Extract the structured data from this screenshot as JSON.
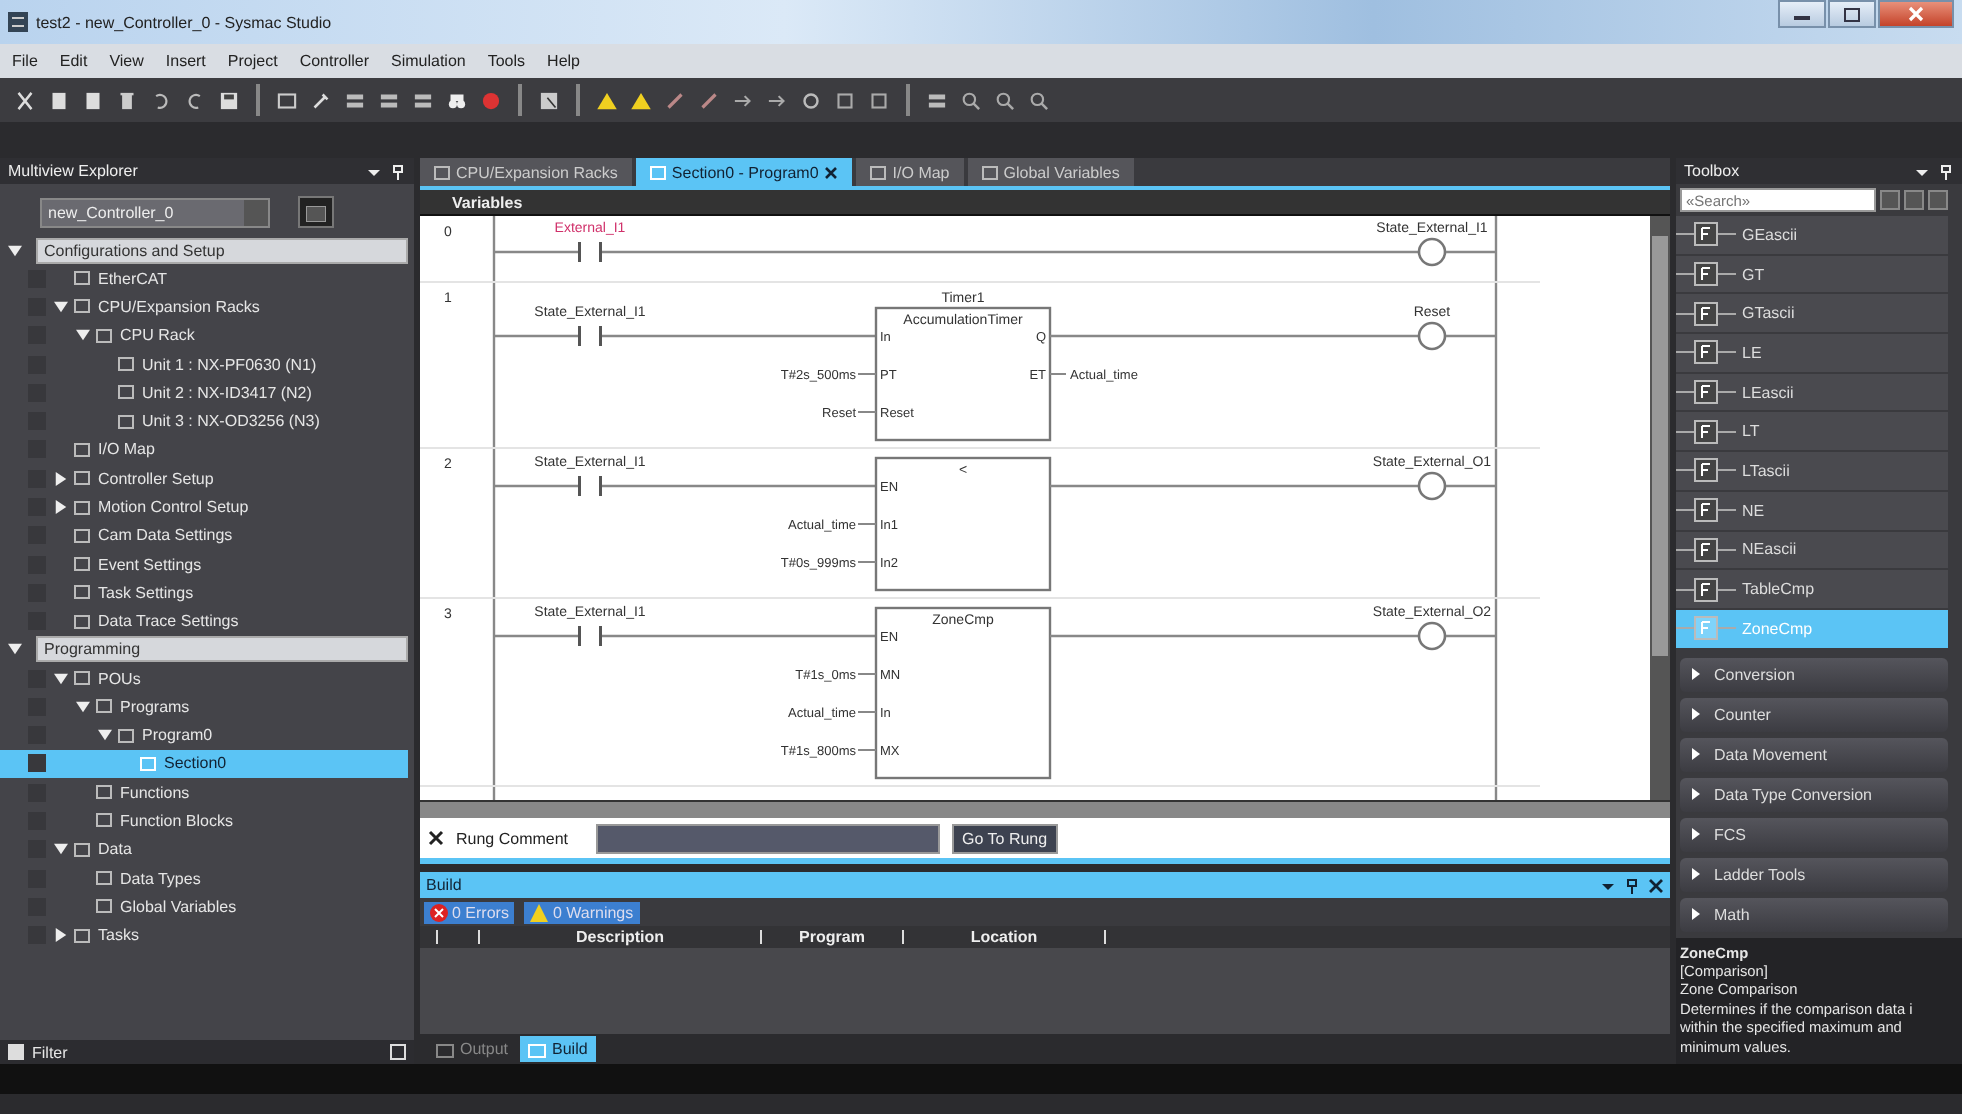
{
  "window": {
    "title": "test2 - new_Controller_0 - Sysmac Studio"
  },
  "menu": [
    "File",
    "Edit",
    "View",
    "Insert",
    "Project",
    "Controller",
    "Simulation",
    "Tools",
    "Help"
  ],
  "explorer": {
    "title": "Multiview Explorer",
    "device": "new_Controller_0",
    "filter": "Filter",
    "tree": [
      {
        "label": "Configurations and Setup",
        "selected": false,
        "expanded": true,
        "children": [
          {
            "label": "EtherCAT",
            "selected": false
          },
          {
            "label": "CPU/Expansion Racks",
            "selected": false,
            "expanded": true,
            "children": [
              {
                "label": "CPU Rack",
                "selected": false,
                "expanded": true,
                "children": [
                  {
                    "label": "Unit 1 : NX-PF0630 (N1)",
                    "selected": false
                  },
                  {
                    "label": "Unit 2 : NX-ID3417 (N2)",
                    "selected": false
                  },
                  {
                    "label": "Unit 3 : NX-OD3256 (N3)",
                    "selected": false
                  }
                ]
              }
            ]
          },
          {
            "label": "I/O Map",
            "selected": false
          },
          {
            "label": "Controller Setup",
            "selected": false,
            "expanded": false
          },
          {
            "label": "Motion Control Setup",
            "selected": false,
            "expanded": false
          },
          {
            "label": "Cam Data Settings",
            "selected": false
          },
          {
            "label": "Event Settings",
            "selected": false
          },
          {
            "label": "Task Settings",
            "selected": false
          },
          {
            "label": "Data Trace Settings",
            "selected": false
          }
        ]
      },
      {
        "label": "Programming",
        "selected": false,
        "expanded": true,
        "children": [
          {
            "label": "POUs",
            "selected": false,
            "expanded": true,
            "children": [
              {
                "label": "Programs",
                "selected": false,
                "expanded": true,
                "children": [
                  {
                    "label": "Program0",
                    "selected": false,
                    "expanded": true,
                    "children": [
                      {
                        "label": "Section0",
                        "selected": true
                      }
                    ]
                  }
                ]
              },
              {
                "label": "Functions",
                "selected": false
              },
              {
                "label": "Function Blocks",
                "selected": false
              }
            ]
          },
          {
            "label": "Data",
            "selected": false,
            "expanded": true,
            "children": [
              {
                "label": "Data Types",
                "selected": false
              },
              {
                "label": "Global Variables",
                "selected": false
              }
            ]
          },
          {
            "label": "Tasks",
            "selected": false,
            "expanded": false
          }
        ]
      }
    ]
  },
  "editor": {
    "tabs": [
      {
        "label": "CPU/Expansion Racks",
        "selected": false,
        "closable": false
      },
      {
        "label": "Section0 - Program0",
        "selected": true,
        "closable": true
      },
      {
        "label": "I/O Map",
        "selected": false,
        "closable": false
      },
      {
        "label": "Global Variables",
        "selected": false,
        "closable": false
      }
    ],
    "variables": "Variables",
    "rungs": [
      {
        "number": "0",
        "contact": {
          "label": "External_I1",
          "invalid": true
        },
        "coil": {
          "label": "State_External_I1"
        }
      },
      {
        "number": "1",
        "contact": {
          "label": "State_External_I1",
          "invalid": false
        },
        "block": {
          "instance": "Timer1",
          "type": "AccumulationTimer",
          "inputs": [
            {
              "pin": "In"
            },
            {
              "pin": "PT",
              "var": "T#2s_500ms"
            },
            {
              "pin": "Reset",
              "var": "Reset"
            }
          ],
          "outputs": [
            {
              "pin": "Q"
            },
            {
              "pin": "ET",
              "var": "Actual_time"
            }
          ]
        },
        "coil": {
          "label": "Reset"
        }
      },
      {
        "number": "2",
        "contact": {
          "label": "State_External_I1",
          "invalid": false
        },
        "block": {
          "type": "<",
          "inputs": [
            {
              "pin": "EN"
            },
            {
              "pin": "In1",
              "var": "Actual_time"
            },
            {
              "pin": "In2",
              "var": "T#0s_999ms"
            }
          ]
        },
        "coil": {
          "label": "State_External_O1"
        }
      },
      {
        "number": "3",
        "contact": {
          "label": "State_External_I1",
          "invalid": false
        },
        "block": {
          "type": "ZoneCmp",
          "inputs": [
            {
              "pin": "EN"
            },
            {
              "pin": "MN",
              "var": "T#1s_0ms"
            },
            {
              "pin": "In",
              "var": "Actual_time"
            },
            {
              "pin": "MX",
              "var": "T#1s_800ms"
            }
          ]
        },
        "coil": {
          "label": "State_External_O2"
        }
      }
    ],
    "rung_comment": {
      "label": "Rung Comment",
      "button": "Go To Rung"
    }
  },
  "build": {
    "title": "Build",
    "errors": "0 Errors",
    "warnings": "0 Warnings",
    "columns": [
      "Description",
      "Program",
      "Location"
    ]
  },
  "bottom_tabs": [
    {
      "label": "Output",
      "selected": false
    },
    {
      "label": "Build",
      "selected": true
    }
  ],
  "toolbox": {
    "title": "Toolbox",
    "search": {
      "placeholder": "«Search»"
    },
    "functions": [
      {
        "label": "GEascii",
        "selected": false
      },
      {
        "label": "GT",
        "selected": false
      },
      {
        "label": "GTascii",
        "selected": false
      },
      {
        "label": "LE",
        "selected": false
      },
      {
        "label": "LEascii",
        "selected": false
      },
      {
        "label": "LT",
        "selected": false
      },
      {
        "label": "LTascii",
        "selected": false
      },
      {
        "label": "NE",
        "selected": false
      },
      {
        "label": "NEascii",
        "selected": false
      },
      {
        "label": "TableCmp",
        "selected": false
      },
      {
        "label": "ZoneCmp",
        "selected": true
      }
    ],
    "categories": [
      {
        "label": "Conversion",
        "expanded": false
      },
      {
        "label": "Counter",
        "expanded": false
      },
      {
        "label": "Data Movement",
        "expanded": false
      },
      {
        "label": "Data Type Conversion",
        "expanded": false
      },
      {
        "label": "FCS",
        "expanded": false
      },
      {
        "label": "Ladder Tools",
        "expanded": false
      },
      {
        "label": "Math",
        "expanded": false
      }
    ],
    "description": {
      "name": "ZoneCmp",
      "lines": [
        "[Comparison]",
        "Zone Comparison",
        "Determines if the comparison data i",
        "within the specified maximum and",
        "minimum values."
      ]
    }
  }
}
